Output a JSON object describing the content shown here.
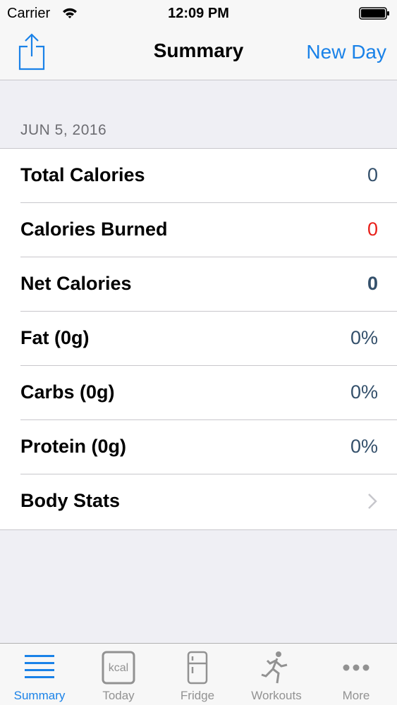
{
  "status_bar": {
    "carrier": "Carrier",
    "time": "12:09 PM"
  },
  "nav": {
    "title": "Summary",
    "new_day_label": "New Day"
  },
  "section": {
    "date": "JUN 5, 2016"
  },
  "rows": [
    {
      "label": "Total Calories",
      "value": "0"
    },
    {
      "label": "Calories Burned",
      "value": "0"
    },
    {
      "label": "Net Calories",
      "value": "0"
    },
    {
      "label": "Fat (0g)",
      "value": "0%"
    },
    {
      "label": "Carbs (0g)",
      "value": "0%"
    },
    {
      "label": "Protein (0g)",
      "value": "0%"
    },
    {
      "label": "Body Stats",
      "value": ""
    }
  ],
  "tabs": [
    {
      "label": "Summary",
      "icon": "list-icon"
    },
    {
      "label": "Today",
      "icon": "kcal-icon",
      "icon_text": "kcal"
    },
    {
      "label": "Fridge",
      "icon": "fridge-icon"
    },
    {
      "label": "Workouts",
      "icon": "runner-icon"
    },
    {
      "label": "More",
      "icon": "more-icon"
    }
  ],
  "colors": {
    "accent": "#1a82e8",
    "burned": "#e8201a",
    "value": "#34506b"
  }
}
